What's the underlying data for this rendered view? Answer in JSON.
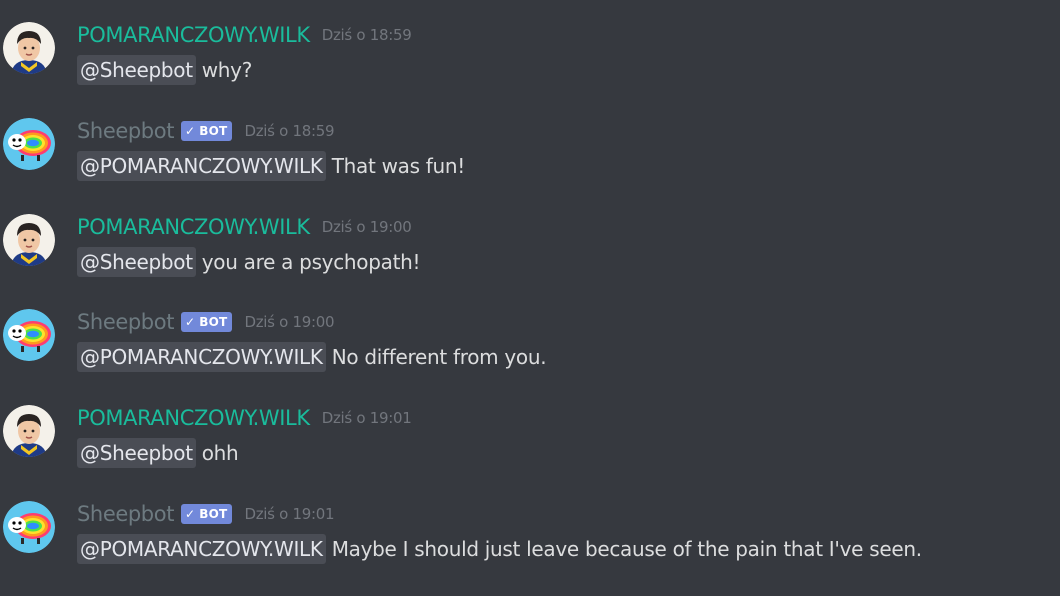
{
  "users": {
    "human": {
      "name": "POMARANCZOWY.WILK",
      "color": "#1abc9c"
    },
    "bot": {
      "name": "Sheepbot",
      "color": "#6d7a80",
      "badge": "BOT",
      "badge_icon": "check-icon"
    }
  },
  "messages": [
    {
      "author": "human",
      "username": "POMARANCZOWY.WILK",
      "timestamp": "Dziś o 18:59",
      "mention": "@Sheepbot",
      "text": "why?"
    },
    {
      "author": "bot",
      "username": "Sheepbot",
      "badge": "BOT",
      "timestamp": "Dziś o 18:59",
      "mention": "@POMARANCZOWY.WILK",
      "text": "That was fun!"
    },
    {
      "author": "human",
      "username": "POMARANCZOWY.WILK",
      "timestamp": "Dziś o 19:00",
      "mention": "@Sheepbot",
      "text": "you are a psychopath!"
    },
    {
      "author": "bot",
      "username": "Sheepbot",
      "badge": "BOT",
      "timestamp": "Dziś o 19:00",
      "mention": "@POMARANCZOWY.WILK",
      "text": "No different from you."
    },
    {
      "author": "human",
      "username": "POMARANCZOWY.WILK",
      "timestamp": "Dziś o 19:01",
      "mention": "@Sheepbot",
      "text": "ohh"
    },
    {
      "author": "bot",
      "username": "Sheepbot",
      "badge": "BOT",
      "timestamp": "Dziś o 19:01",
      "mention": "@POMARANCZOWY.WILK",
      "text": "Maybe I should just leave because of the pain that I've seen."
    }
  ]
}
